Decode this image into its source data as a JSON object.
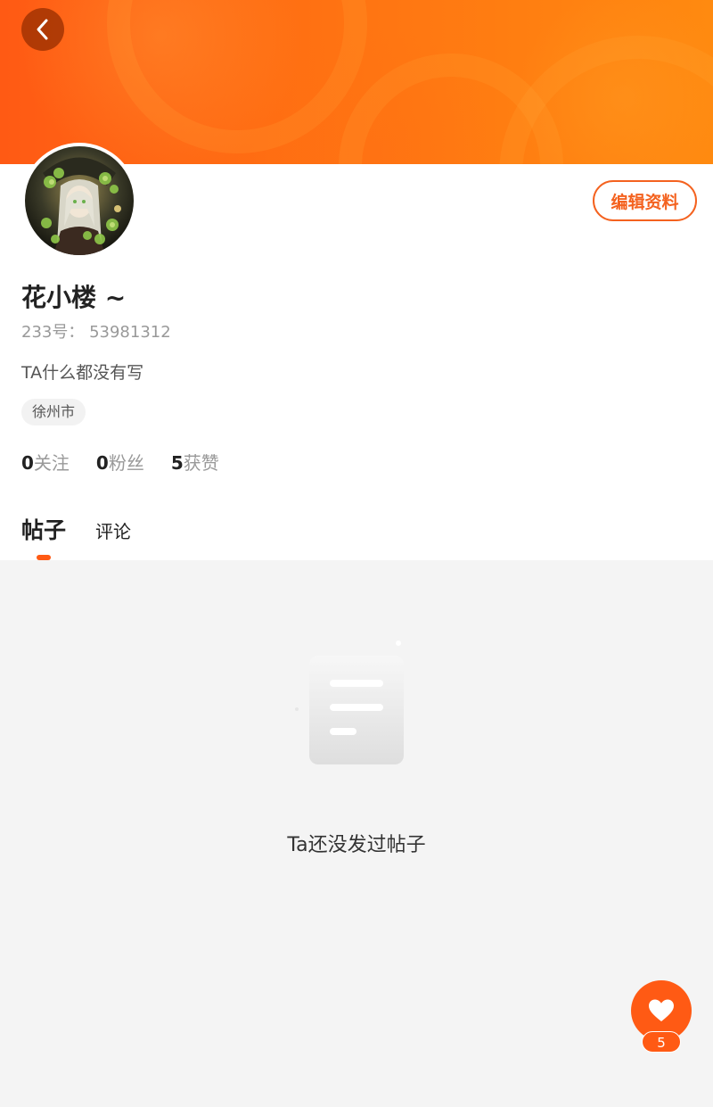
{
  "colors": {
    "accent": "#ff5a14",
    "edit_border": "#f4621f",
    "page_bg": "#f4f4f4"
  },
  "header": {
    "back_icon": "chevron-left-icon"
  },
  "profile": {
    "avatar_icon": "avatar-image",
    "edit_label": "编辑资料",
    "username": "花小楼 ~",
    "user_id": "233号： 53981312",
    "bio": "TA什么都没有写",
    "location": "徐州市"
  },
  "stats": [
    {
      "count": "0",
      "label": "关注"
    },
    {
      "count": "0",
      "label": "粉丝"
    },
    {
      "count": "5",
      "label": "获赞"
    }
  ],
  "tabs": [
    {
      "label": "帖子",
      "active": true
    },
    {
      "label": "评论",
      "active": false
    }
  ],
  "empty_state": {
    "icon": "document-icon",
    "text": "Ta还没发过帖子"
  },
  "like_fab": {
    "icon": "heart-icon",
    "count": "5"
  }
}
